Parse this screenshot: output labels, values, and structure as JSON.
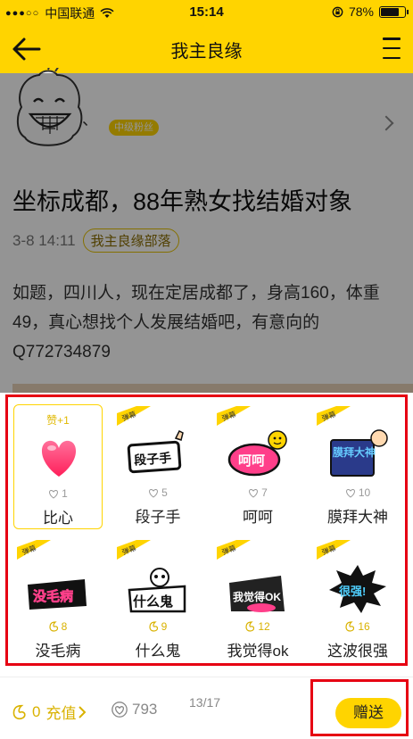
{
  "status_bar": {
    "carrier": "中国联通",
    "time": "15:14",
    "battery_percent": "78%",
    "battery_level": 0.78
  },
  "nav": {
    "title": "我主良缘",
    "back_icon": "back-arrow-icon",
    "menu_icon": "menu-icon"
  },
  "post": {
    "author_suffix": "、",
    "fan_badge": "中级粉丝",
    "title": "坐标成都，88年熟女找结婚对象",
    "date": "3-8 14:11",
    "tag": "我主良缘部落",
    "body": "如题，四川人，现在定居成都了，身高160，体重49，真心想找个人发展结婚吧，有意向的Q772734879"
  },
  "gifts": [
    {
      "label": "比心",
      "count": "1",
      "currency": "heart",
      "selected": true,
      "bonus": "赞+1",
      "art_text": ""
    },
    {
      "label": "段子手",
      "count": "5",
      "currency": "heart",
      "selected": false,
      "danmu": "弹幕",
      "art_text": "段子手"
    },
    {
      "label": "呵呵",
      "count": "7",
      "currency": "heart",
      "selected": false,
      "danmu": "弹幕",
      "art_text": "呵呵"
    },
    {
      "label": "膜拜大神",
      "count": "10",
      "currency": "heart",
      "selected": false,
      "danmu": "弹幕",
      "art_text": "膜拜大神"
    },
    {
      "label": "没毛病",
      "count": "8",
      "currency": "coin",
      "selected": false,
      "danmu": "弹幕",
      "art_text": "没毛病"
    },
    {
      "label": "什么鬼",
      "count": "9",
      "currency": "coin",
      "selected": false,
      "danmu": "弹幕",
      "art_text": "什么鬼"
    },
    {
      "label": "我觉得ok",
      "count": "12",
      "currency": "coin",
      "selected": false,
      "danmu": "弹幕",
      "art_text": "我觉得OK"
    },
    {
      "label": "这波很强",
      "count": "16",
      "currency": "coin",
      "selected": false,
      "danmu": "弹幕",
      "art_text": "很强!"
    }
  ],
  "bottom": {
    "coin_balance": "0",
    "recharge_label": "充值",
    "heart_balance": "793",
    "page_indicator": "13/17",
    "send_label": "赠送"
  },
  "colors": {
    "brand_yellow": "#ffd400",
    "highlight_red": "#e60012"
  }
}
